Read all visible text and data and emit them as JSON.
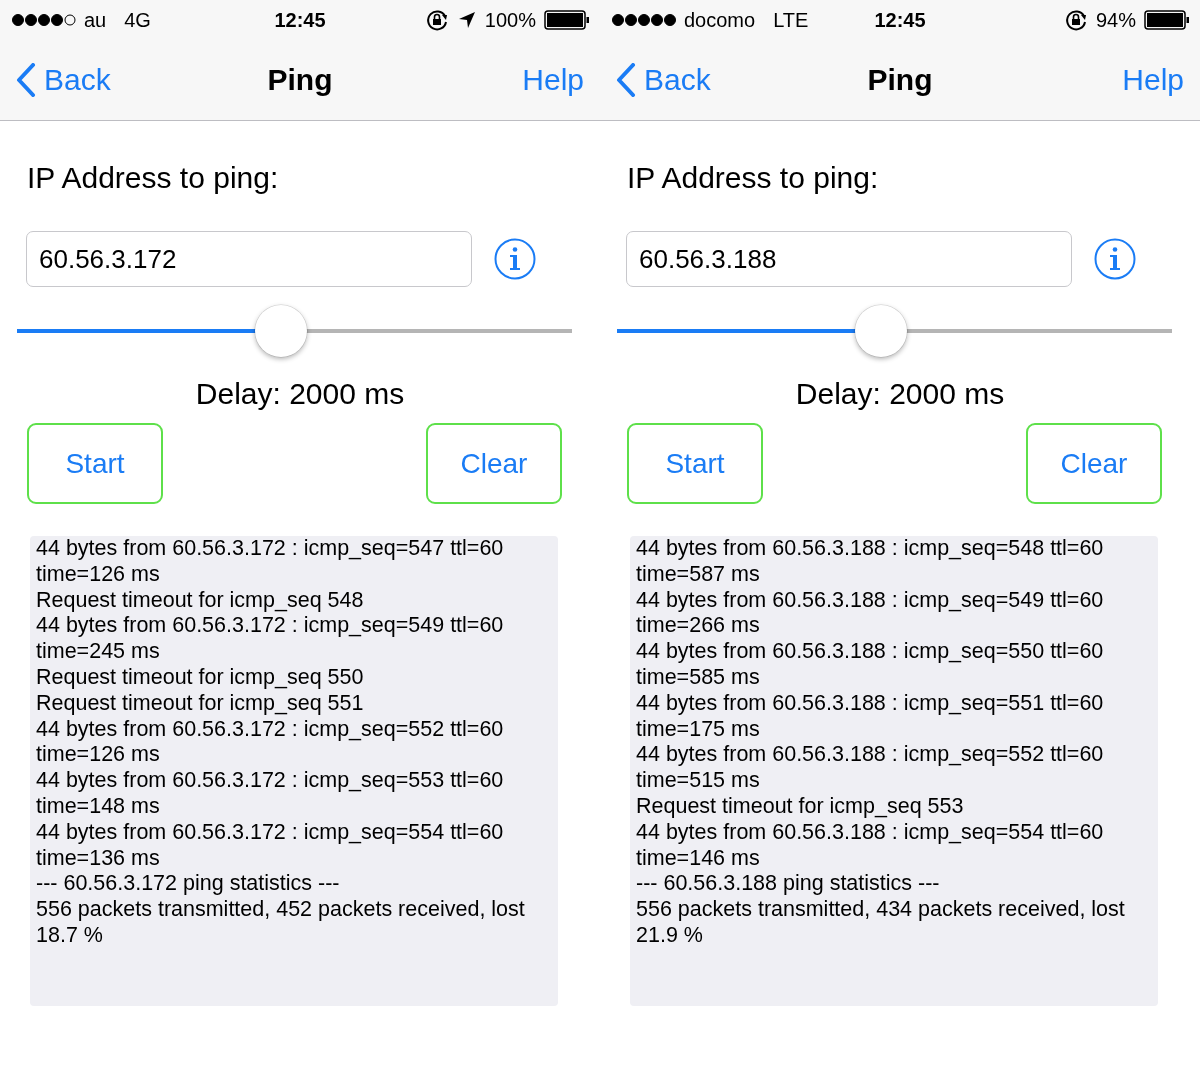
{
  "phones": [
    {
      "status_bar": {
        "signal_full": false,
        "carrier": "au",
        "network": "4G",
        "time": "12:45",
        "location": true,
        "battery": "100%"
      },
      "nav": {
        "back": "Back",
        "title": "Ping",
        "help": "Help"
      },
      "label": "IP Address to ping:",
      "address": "60.56.3.172",
      "delay": {
        "level": 0.475,
        "text": "Delay: 2000 ms"
      },
      "buttons": [
        "Start",
        "Clear"
      ],
      "log": [
        "44 bytes from 60.56.3.172 : icmp_seq=547 ttl=60 time=126 ms",
        "Request timeout for icmp_seq 548",
        "44 bytes from 60.56.3.172 : icmp_seq=549 ttl=60 time=245 ms",
        "Request timeout for icmp_seq 550",
        "Request timeout for icmp_seq 551",
        "44 bytes from 60.56.3.172 : icmp_seq=552 ttl=60 time=126 ms",
        "44 bytes from 60.56.3.172 : icmp_seq=553 ttl=60 time=148 ms",
        "44 bytes from 60.56.3.172 : icmp_seq=554 ttl=60 time=136 ms",
        "--- 60.56.3.172 ping statistics ---",
        "556 packets transmitted, 452 packets received, lost 18.7 %"
      ]
    },
    {
      "status_bar": {
        "signal_full": true,
        "carrier": "docomo",
        "network": "LTE",
        "time": "12:45",
        "location": false,
        "battery": "94%"
      },
      "nav": {
        "back": "Back",
        "title": "Ping",
        "help": "Help"
      },
      "label": "IP Address to ping:",
      "address": "60.56.3.188",
      "delay": {
        "level": 0.475,
        "text": "Delay: 2000 ms"
      },
      "buttons": [
        "Start",
        "Clear"
      ],
      "log": [
        "44 bytes from 60.56.3.188 : icmp_seq=548 ttl=60 time=587 ms",
        "44 bytes from 60.56.3.188 : icmp_seq=549 ttl=60 time=266 ms",
        "44 bytes from 60.56.3.188 : icmp_seq=550 ttl=60 time=585 ms",
        "44 bytes from 60.56.3.188 : icmp_seq=551 ttl=60 time=175 ms",
        "44 bytes from 60.56.3.188 : icmp_seq=552 ttl=60 time=515 ms",
        "Request timeout for icmp_seq 553",
        "44 bytes from 60.56.3.188 : icmp_seq=554 ttl=60 time=146 ms",
        "--- 60.56.3.188 ping statistics ---",
        "556 packets transmitted, 434 packets received, lost 21.9 %"
      ]
    }
  ]
}
